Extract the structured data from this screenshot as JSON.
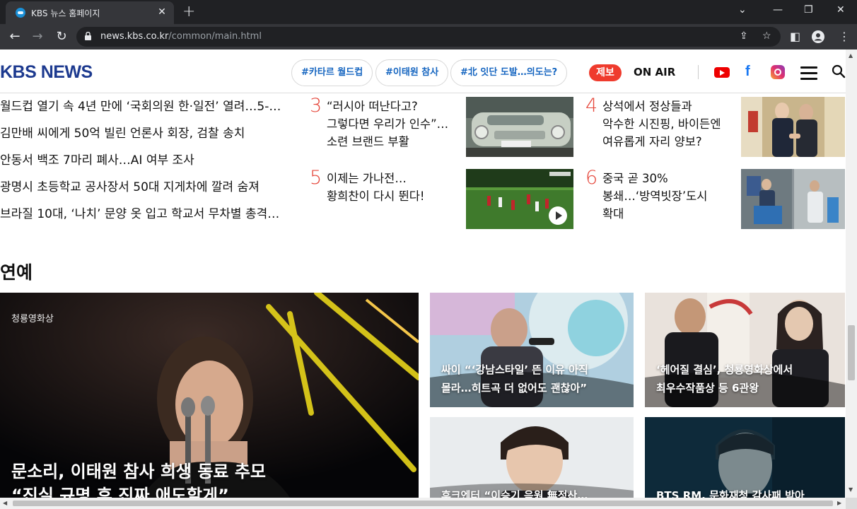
{
  "browser": {
    "tab_title": "KBS 뉴스 홈페이지",
    "url_host": "news.kbs.co.kr",
    "url_path": "/common/main.html"
  },
  "header": {
    "logo": "KBS NEWS",
    "tags": [
      "#카타르 월드컵",
      "#이태원 참사",
      "#北 잇단 도발…의도는?"
    ],
    "report_label": "제보",
    "onair_label": "ON AIR"
  },
  "headlines": [
    "월드컵 열기 속 4년 만에 ‘국회의원 한·일전’ 열려…5-…",
    "김만배 씨에게 50억 빌린 언론사 회장, 검찰 송치",
    "안동서 백조 7마리 폐사…AI 여부 조사",
    "광명시 초등학교 공사장서 50대 지게차에 깔려 숨져",
    "브라질 10대, ‘나치’ 문양 옷 입고 학교서 무차별 총격…"
  ],
  "ranked": [
    {
      "num": "3",
      "text": "“러시아 떠난다고?\n그렇다면 우리가 인수”…\n소련 브랜드 부활"
    },
    {
      "num": "4",
      "text": "상석에서 정상들과\n악수한 시진핑, 바이든엔\n여유롭게 자리 양보?"
    },
    {
      "num": "5",
      "text": "이제는 가나전…\n황희찬이 다시 뛴다!"
    },
    {
      "num": "6",
      "text": "중국 곧 30%\n봉쇄…‘방역빗장’도시\n확대"
    }
  ],
  "entertainment": {
    "section_title": "연예",
    "main_caption": "문소리, 이태원 참사 희생 동료 추모\n“진실 규명 후 진짜 애도할게”",
    "award_logo": "청룡영화상",
    "cards": [
      "싸이 “‘강남스타일’ 뜬 이유 아직\n몰라…히트곡 더 없어도 괜찮아”",
      "‘헤어질 결심’, 청룡영화상에서\n최우수작품상 등 6관왕",
      "후크엔터 “이승기 음원 無정산…",
      "BTS RM, 문화재청 감사패 받아"
    ]
  }
}
